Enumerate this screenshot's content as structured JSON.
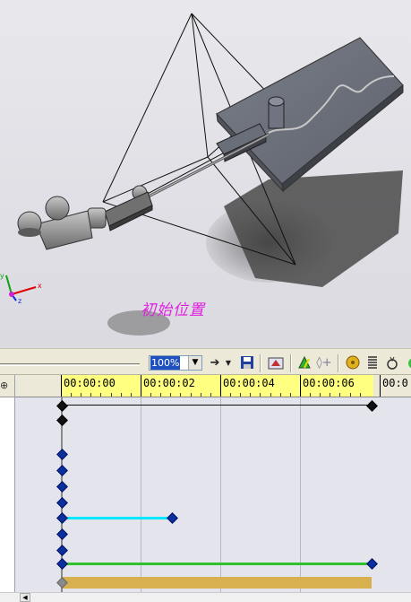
{
  "viewport": {
    "caption": "初始位置",
    "axis_labels": {
      "x": "x",
      "y": "y",
      "z": "z"
    }
  },
  "toolbar": {
    "zoom_value": "100%",
    "icons": [
      "arrow-right-icon",
      "dropdown-arrow-icon",
      "save-icon",
      "animation-wizard-icon",
      "autokey-icon",
      "add-key-icon",
      "motor-icon",
      "spring-icon",
      "contact-icon",
      "gravity-icon"
    ]
  },
  "timeline": {
    "ruler_labels": [
      "00:00:00",
      "00:00:02",
      "00:00:04",
      "00:00:06",
      "00:0"
    ],
    "tree_header": "⊕"
  },
  "colors": {
    "ruler": "#ffff80",
    "cyan_track": "#00e8ff",
    "green_track": "#30c030",
    "gold_track": "#d8b050",
    "caption": "#e020e0"
  }
}
